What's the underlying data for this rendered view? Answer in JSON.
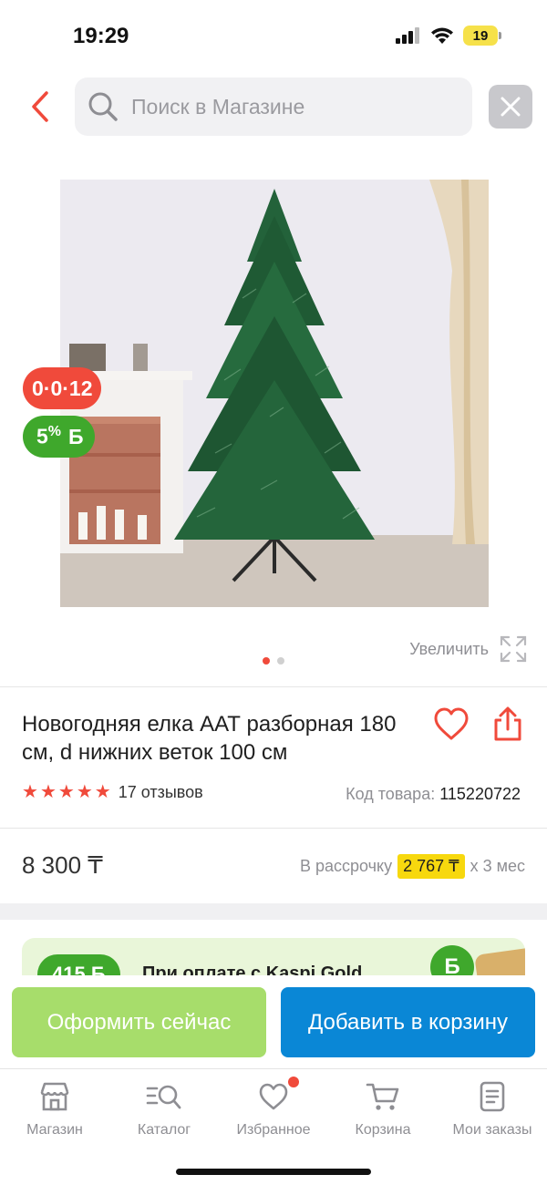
{
  "status_bar": {
    "time": "19:29",
    "battery": "19"
  },
  "search": {
    "placeholder": "Поиск в Магазине"
  },
  "product": {
    "badge_installment": "0·0·12",
    "badge_bonus_value": "5",
    "badge_bonus_percent": "%",
    "badge_bonus_currency": "Б",
    "zoom_label": "Увеличить",
    "title": "Новогодняя елка ААТ разборная 180 см, d нижних веток 100 см",
    "rating_stars": 5,
    "reviews": "17 отзывов",
    "sku_label": "Код товара:",
    "sku_value": "115220722",
    "price": "8 300 ₸",
    "installment_label": "В рассрочку",
    "installment_amount": "2 767 ₸",
    "installment_term": "х 3 мес"
  },
  "promo": {
    "badge": "415 Б",
    "text": "При оплате с Kaspi Gold",
    "coin": "Б"
  },
  "actions": {
    "buy_now": "Оформить сейчас",
    "add_to_cart": "Добавить в корзину"
  },
  "tabs": [
    {
      "label": "Магазин",
      "icon": "store-icon"
    },
    {
      "label": "Каталог",
      "icon": "catalog-search-icon"
    },
    {
      "label": "Избранное",
      "icon": "heart-icon"
    },
    {
      "label": "Корзина",
      "icon": "cart-icon"
    },
    {
      "label": "Мои заказы",
      "icon": "orders-icon"
    }
  ],
  "colors": {
    "accent_red": "#f04a3b",
    "bonus_green": "#3fa82c",
    "buy_green": "#a7dd6b",
    "cart_blue": "#0a87d6",
    "installment_yellow": "#f7d80e"
  }
}
